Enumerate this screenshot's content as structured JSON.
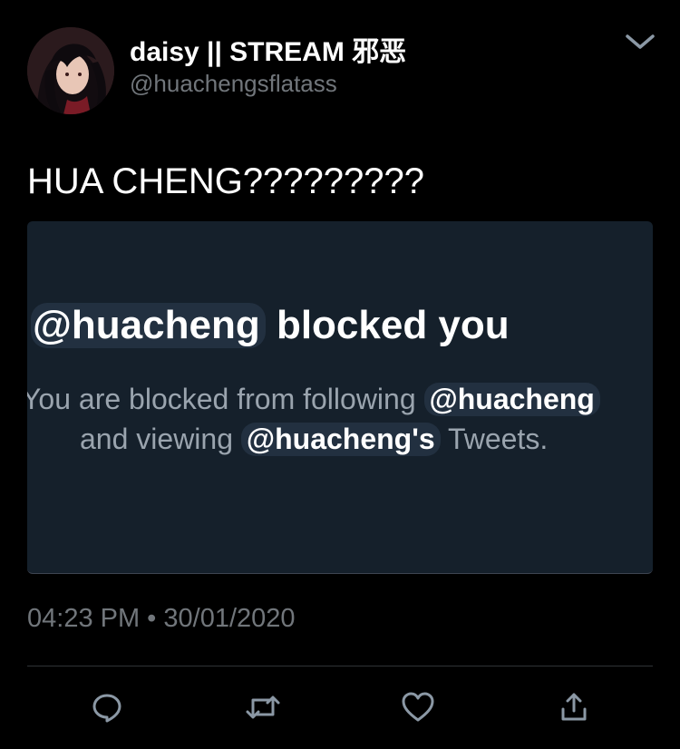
{
  "author": {
    "display_name": "daisy || STREAM 邪恶",
    "handle": "@huachengsflatass"
  },
  "tweet": {
    "text": "HUA CHENG?????????",
    "timestamp": "04:23 PM • 30/01/2020"
  },
  "media": {
    "mention": "@huacheng",
    "heading_rest": "blocked you",
    "line1_prefix": "You are blocked from following",
    "line1_mention": "@huacheng",
    "line2_prefix": "and viewing",
    "line2_mention": "@huacheng's",
    "line2_suffix": "Tweets."
  },
  "icons": {
    "menu": "chevron-down-icon",
    "reply": "reply-icon",
    "retweet": "retweet-icon",
    "like": "heart-icon",
    "share": "share-icon"
  },
  "colors": {
    "background": "#000000",
    "secondary_text": "#71767b",
    "media_background": "#15202b",
    "icon_color": "#8b98a5"
  }
}
